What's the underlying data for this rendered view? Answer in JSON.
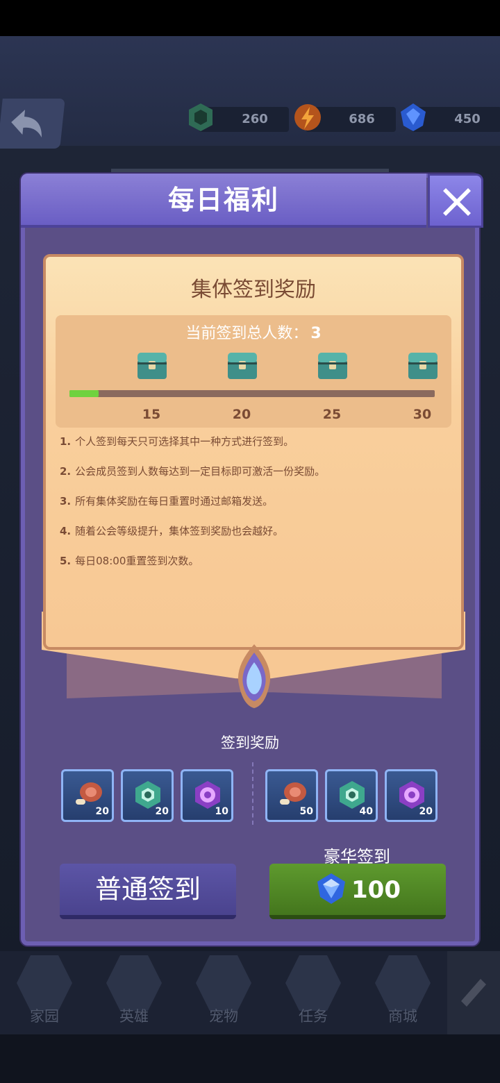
{
  "resources": [
    {
      "icon": "green-token-icon",
      "value": "260"
    },
    {
      "icon": "orange-energy-icon",
      "value": "686"
    },
    {
      "icon": "blue-diamond-icon",
      "value": "450"
    }
  ],
  "modal": {
    "title": "每日福利",
    "panel_title": "集体签到奖励",
    "count_label": "当前签到总人数：",
    "count_value": "3",
    "progress": {
      "current": 3,
      "max": 30
    },
    "milestones": [
      "15",
      "20",
      "25",
      "30"
    ],
    "rules": [
      {
        "num": "1.",
        "text": "个人签到每天只可选择其中一种方式进行签到。"
      },
      {
        "num": "2.",
        "text": "公会成员签到人数每达到一定目标即可激活一份奖励。"
      },
      {
        "num": "3.",
        "text": "所有集体奖励在每日重置时通过邮箱发送。"
      },
      {
        "num": "4.",
        "text": "随着公会等级提升，集体签到奖励也会越好。"
      },
      {
        "num": "5.",
        "text": "每日08:00重置签到次数。"
      }
    ],
    "reward_label": "签到奖励",
    "normal_rewards": [
      {
        "icon": "meat-icon",
        "qty": "20"
      },
      {
        "icon": "green-token-icon",
        "qty": "20"
      },
      {
        "icon": "purple-token-icon",
        "qty": "10"
      }
    ],
    "lux_rewards": [
      {
        "icon": "meat-icon",
        "qty": "50"
      },
      {
        "icon": "green-token-icon",
        "qty": "40"
      },
      {
        "icon": "purple-token-icon",
        "qty": "20"
      }
    ],
    "lux_label": "豪华签到",
    "normal_button": "普通签到",
    "lux_cost": "100"
  },
  "nav": [
    "家园",
    "英雄",
    "宠物",
    "任务",
    "商城"
  ],
  "colors": {
    "progress_fill": "#6fd23f",
    "lux_button": "#5e9a2e",
    "normal_button": "#5c55a6"
  }
}
